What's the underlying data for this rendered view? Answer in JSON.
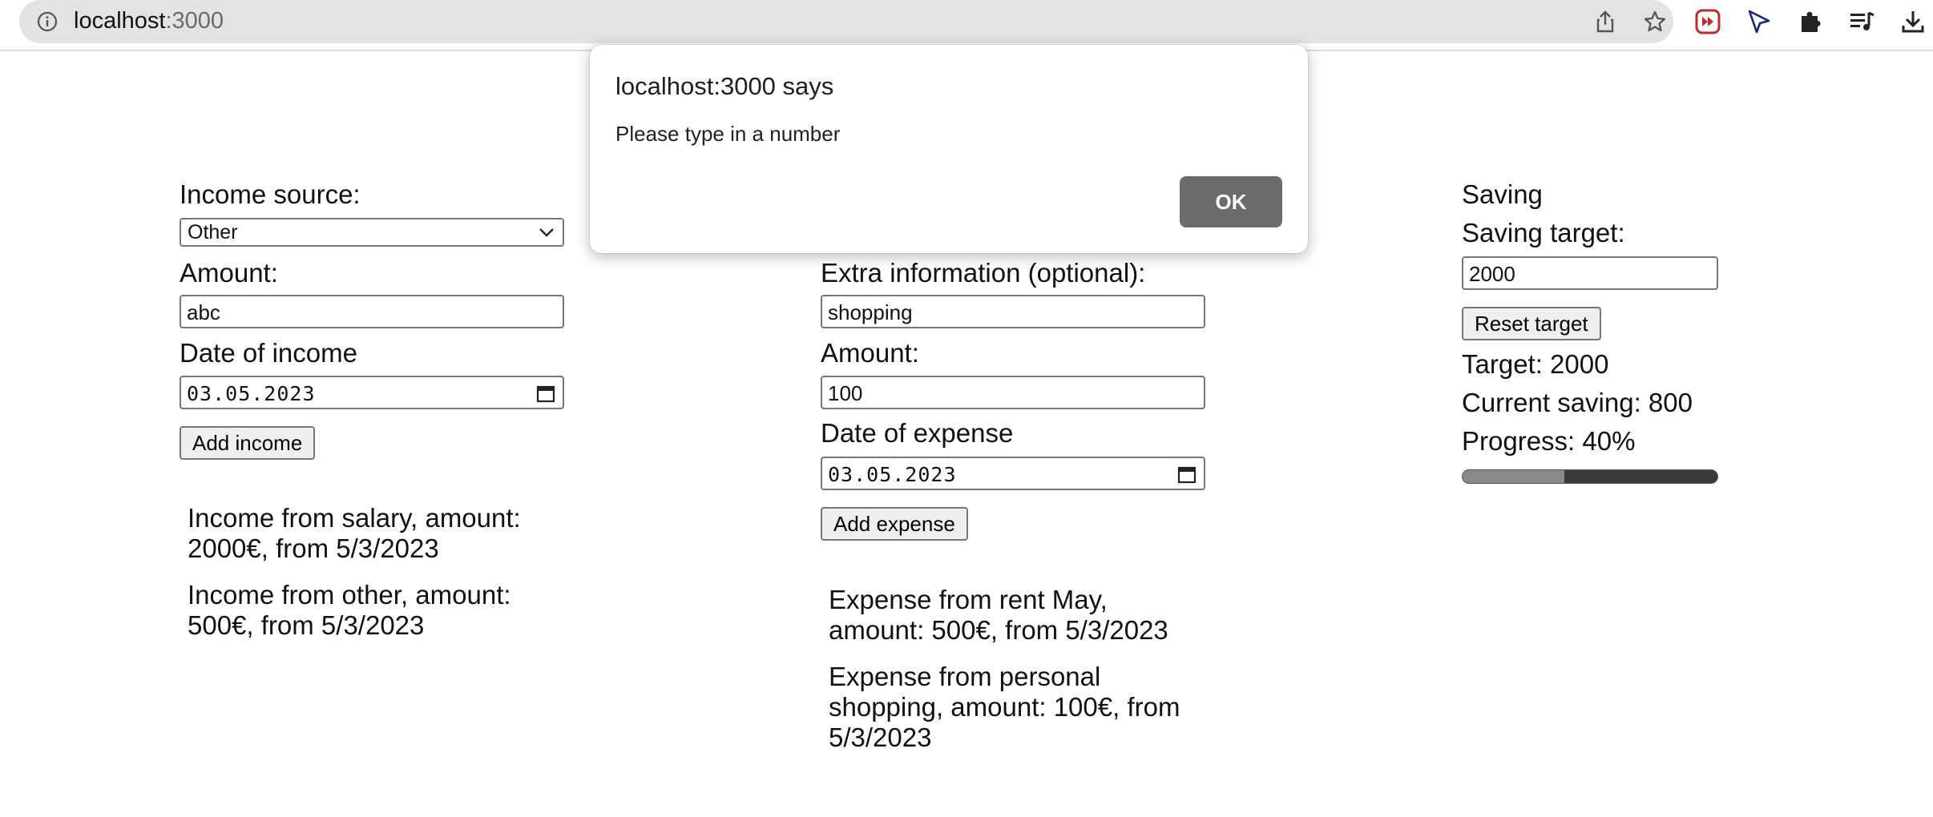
{
  "browser": {
    "url_host": "localhost",
    "url_port": ":3000",
    "icons": [
      "info-icon",
      "share-icon",
      "star-icon",
      "extension-red-icon",
      "cursor-icon",
      "puzzle-icon",
      "playlist-icon",
      "download-icon"
    ]
  },
  "income": {
    "source_label": "Income source:",
    "source_value": "Other",
    "amount_label": "Amount:",
    "amount_value": "abc",
    "date_label": "Date of income",
    "date_value": "03.05.2023",
    "add_button": "Add income",
    "entries": [
      {
        "line1": "Income from salary, amount:",
        "line2": "2000€, from 5/3/2023"
      },
      {
        "line1": "Income from other, amount:",
        "line2": "500€, from 5/3/2023"
      }
    ]
  },
  "expense": {
    "extra_label": "Extra information (optional):",
    "extra_value": "shopping",
    "amount_label": "Amount:",
    "amount_value": "100",
    "date_label": "Date of expense",
    "date_value": "03.05.2023",
    "add_button": "Add expense",
    "entries": [
      {
        "line1": "Expense from rent May,",
        "line2": "amount: 500€, from 5/3/2023",
        "line3": ""
      },
      {
        "line1": "Expense from personal",
        "line2": "shopping, amount: 100€, from",
        "line3": "5/3/2023"
      }
    ]
  },
  "saving": {
    "heading": "Saving",
    "target_label": "Saving target:",
    "target_value": "2000",
    "reset_button": "Reset target",
    "target_text": "Target: 2000",
    "current_text": "Current saving: 800",
    "progress_text": "Progress: 40%",
    "progress_fraction": 0.4
  },
  "dialog": {
    "title": "localhost:3000 says",
    "message": "Please type in a number",
    "ok_label": "OK"
  },
  "colors": {
    "dialog_button": "#6b6b6b",
    "progress_fill": "#8a8a8a",
    "progress_track": "#3a3a3a",
    "extension_red": "#c62828"
  }
}
